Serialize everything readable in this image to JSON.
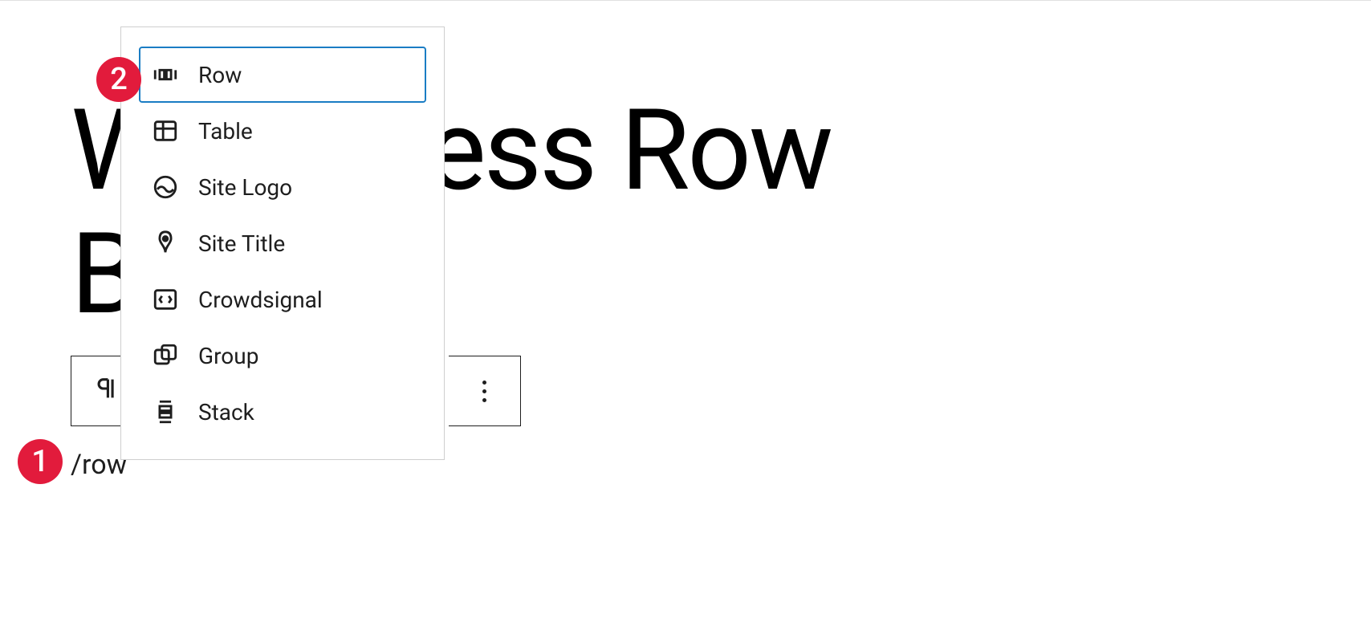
{
  "post_title_line1": "WordPress Row",
  "post_title_line2": "Block",
  "slash_command": "/row",
  "badges": {
    "one": "1",
    "two": "2"
  },
  "popover": {
    "items": [
      {
        "label": "Row",
        "icon": "row-icon",
        "selected": true
      },
      {
        "label": "Table",
        "icon": "table-icon",
        "selected": false
      },
      {
        "label": "Site Logo",
        "icon": "site-logo-icon",
        "selected": false
      },
      {
        "label": "Site Title",
        "icon": "site-title-icon",
        "selected": false
      },
      {
        "label": "Crowdsignal",
        "icon": "crowdsignal-icon",
        "selected": false
      },
      {
        "label": "Group",
        "icon": "group-icon",
        "selected": false
      },
      {
        "label": "Stack",
        "icon": "stack-icon",
        "selected": false
      }
    ]
  }
}
